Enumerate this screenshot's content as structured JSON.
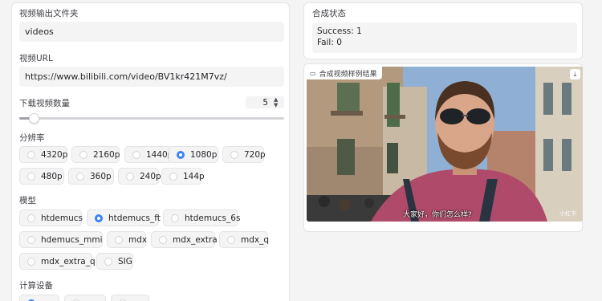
{
  "left": {
    "output_folder_label": "视频输出文件夹",
    "output_folder_value": "videos",
    "url_label": "视频URL",
    "url_value": "https://www.bilibili.com/video/BV1kr421M7vz/",
    "count_label": "下载视频数量",
    "count_value": "5",
    "count_slider_fraction": 0.05,
    "resolution_label": "分辨率",
    "resolution_options": [
      "4320p",
      "2160p",
      "1440p",
      "1080p",
      "720p",
      "480p",
      "360p",
      "240p",
      "144p"
    ],
    "resolution_selected": "1080p",
    "model_label": "模型",
    "model_options": [
      "htdemucs",
      "htdemucs_ft",
      "htdemucs_6s",
      "hdemucs_mmi",
      "mdx",
      "mdx_extra",
      "mdx_q",
      "mdx_extra_q",
      "SIG"
    ],
    "model_selected": "htdemucs_ft",
    "device_label": "计算设备"
  },
  "right": {
    "status_label": "合成状态",
    "status_success": "Success: 1",
    "status_fail": "Fail: 0",
    "video_label": "合成视频样例结果",
    "video_subtitle": "大家好，你们怎么样?",
    "video_watermark": "小红书"
  },
  "colors": {
    "accent": "#3b82f6",
    "panel_bg": "#ffffff",
    "page_bg": "#f4f4f5"
  },
  "icons": {
    "video": "video-camera-icon",
    "download": "download-icon",
    "stepper": "up-down-arrows-icon"
  }
}
